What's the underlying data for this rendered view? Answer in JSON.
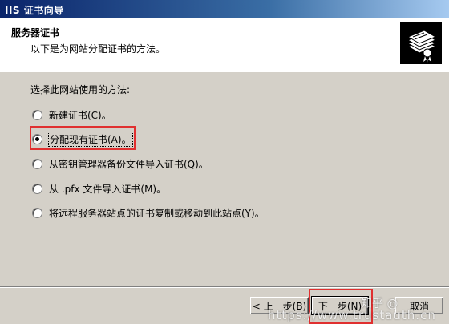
{
  "window": {
    "title": "IIS 证书向导"
  },
  "header": {
    "title": "服务器证书",
    "subtitle": "以下是为网站分配证书的方法。"
  },
  "content": {
    "prompt": "选择此网站使用的方法:",
    "options": [
      {
        "label": "新建证书(C)。",
        "selected": false
      },
      {
        "label": "分配现有证书(A)。",
        "selected": true
      },
      {
        "label": "从密钥管理器备份文件导入证书(Q)。",
        "selected": false
      },
      {
        "label": "从 .pfx 文件导入证书(M)。",
        "selected": false
      },
      {
        "label": "将远程服务器站点的证书复制或移动到此站点(Y)。",
        "selected": false
      }
    ]
  },
  "footer": {
    "back_label": "< 上一步(B)",
    "next_label": "下一步(N)",
    "cancel_label": "取消"
  },
  "watermark": {
    "site": "知乎 @",
    "url": "https://www.trustauth.cn"
  },
  "colors": {
    "titlebar_start": "#0a246a",
    "highlight": "#e03030",
    "dialog_bg": "#d4d0c8"
  },
  "icons": {
    "wizard_logo": "certificate-stack-icon"
  }
}
